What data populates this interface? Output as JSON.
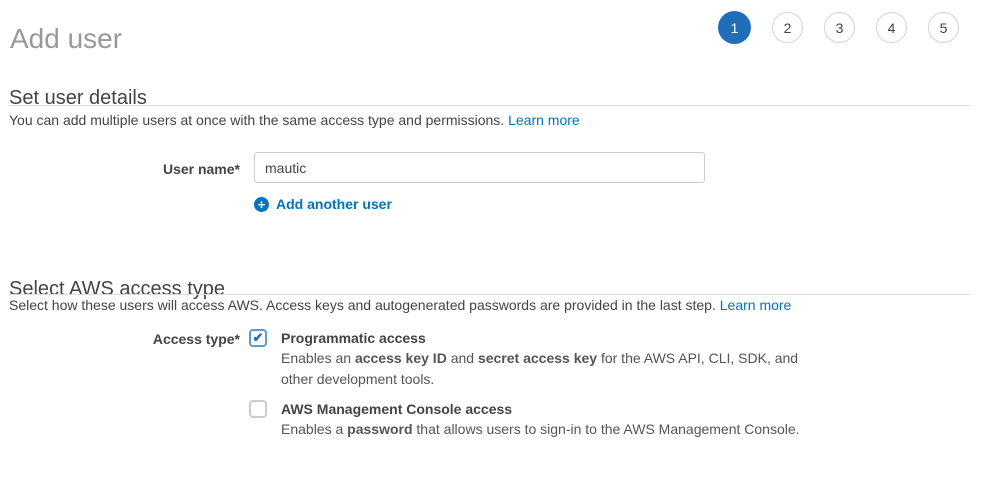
{
  "page": {
    "title": "Add user"
  },
  "steps": {
    "items": [
      "1",
      "2",
      "3",
      "4",
      "5"
    ],
    "active_step": "1"
  },
  "user_details": {
    "heading": "Set user details",
    "intro_text": "You can add multiple users at once with the same access type and permissions.",
    "learn_more": "Learn more",
    "username": {
      "label": "User name*",
      "value": "mautic"
    },
    "add_another_user": "Add another user"
  },
  "access_type": {
    "heading": "Select AWS access type",
    "intro_text": "Select how these users will access AWS. Access keys and autogenerated passwords are provided in the last step.",
    "learn_more": "Learn more",
    "label": "Access type*",
    "options": [
      {
        "name": "Programmatic access",
        "checked": true,
        "desc_1": "Enables an ",
        "desc_bold_1": "access key ID",
        "desc_2": " and ",
        "desc_bold_2": "secret access key",
        "desc_3": " for the AWS API, CLI, SDK, and",
        "desc_line_2": "other development tools."
      },
      {
        "name": "AWS Management Console access",
        "checked": false,
        "desc_1": "Enables a ",
        "desc_bold_1": "password",
        "desc_2": " that allows users to sign-in to the AWS Management Console."
      }
    ]
  },
  "icons": {
    "plus_icon_glyph": "+",
    "checkmark_icon_glyph": "✔"
  },
  "colors": {
    "link_blue": "#0073bb",
    "step_active_blue": "#1f6eb7",
    "title_gray": "#999999",
    "divider_gray": "#dcdcdc"
  }
}
